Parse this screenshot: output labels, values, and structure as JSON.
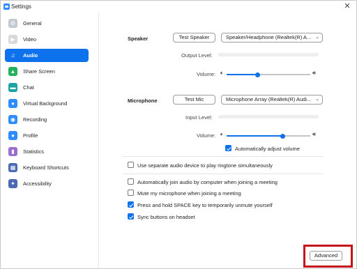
{
  "window": {
    "title": "Settings",
    "close_glyph": "✕"
  },
  "sidebar": {
    "items": [
      {
        "label": "General",
        "icon": "gear-icon",
        "color": "#c4cad2",
        "glyph": "⚙",
        "active": false
      },
      {
        "label": "Video",
        "icon": "video-icon",
        "color": "#d8d8d8",
        "glyph": "▶",
        "active": false
      },
      {
        "label": "Audio",
        "icon": "headphone-icon",
        "color": "#0e72ed",
        "glyph": "♫",
        "active": true
      },
      {
        "label": "Share Screen",
        "icon": "share-screen-icon",
        "color": "#21b25b",
        "glyph": "▲",
        "active": false
      },
      {
        "label": "Chat",
        "icon": "chat-icon",
        "color": "#1ba4a4",
        "glyph": "▬",
        "active": false
      },
      {
        "label": "Virtual Background",
        "icon": "person-icon",
        "color": "#2d8cff",
        "glyph": "●",
        "active": false
      },
      {
        "label": "Recording",
        "icon": "recording-icon",
        "color": "#2d8cff",
        "glyph": "◉",
        "active": false
      },
      {
        "label": "Profile",
        "icon": "profile-icon",
        "color": "#2d8cff",
        "glyph": "●",
        "active": false
      },
      {
        "label": "Statistics",
        "icon": "statistics-icon",
        "color": "#9a6fd0",
        "glyph": "▮",
        "active": false
      },
      {
        "label": "Keyboard Shortcuts",
        "icon": "keyboard-icon",
        "color": "#4b6ab3",
        "glyph": "▦",
        "active": false
      },
      {
        "label": "Accessibility",
        "icon": "accessibility-icon",
        "color": "#4b6ab3",
        "glyph": "✦",
        "active": false
      }
    ]
  },
  "speaker": {
    "label": "Speaker",
    "test_button": "Test Speaker",
    "device": "Speaker/Headphone (Realtek(R) A...",
    "output_level_label": "Output Level:",
    "volume_label": "Volume:",
    "volume_fraction": 0.37
  },
  "microphone": {
    "label": "Microphone",
    "test_button": "Test Mic",
    "device": "Microphone Array (Realtek(R) Audi...",
    "input_level_label": "Input Level:",
    "volume_label": "Volume:",
    "volume_fraction": 0.67
  },
  "options": {
    "auto_adjust": {
      "label": "Automatically adjust volume",
      "checked": true
    },
    "separate_device": {
      "label": "Use separate audio device to play ringtone simultaneously",
      "checked": false
    },
    "auto_join": {
      "label": "Automatically join audio by computer when joining a meeting",
      "checked": false
    },
    "mute_mic": {
      "label": "Mute my microphone when joining a meeting",
      "checked": false
    },
    "space_unmute": {
      "label": "Press and hold SPACE key to temporarily unmute yourself",
      "checked": true
    },
    "sync_headset": {
      "label": "Sync buttons on headset",
      "checked": true
    }
  },
  "footer": {
    "advanced_button": "Advanced"
  },
  "colors": {
    "accent": "#0e72ed",
    "highlight": "#c4131b"
  }
}
